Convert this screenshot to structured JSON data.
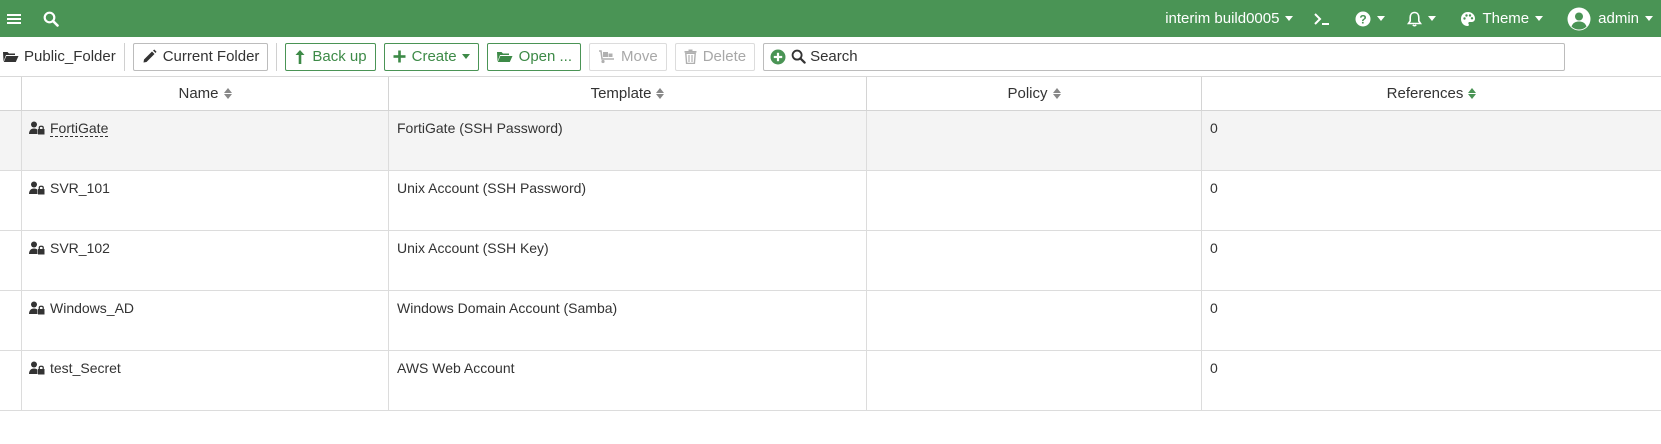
{
  "topbar": {
    "menu_icon": "hamburger-icon",
    "search_icon": "search-icon",
    "build_label": "interim build0005",
    "terminal_icon": "terminal-icon",
    "help_icon": "question-circle-icon",
    "notifications_icon": "bell-icon",
    "theme_icon": "palette-icon",
    "theme_label": "Theme",
    "user_icon": "user-avatar-icon",
    "user_label": "admin",
    "accent_color": "#4a9455"
  },
  "toolbar": {
    "breadcrumb": "Public_Folder",
    "current_folder": "Current Folder",
    "back_up": "Back up",
    "create": "Create",
    "open": "Open ...",
    "move": "Move",
    "delete": "Delete",
    "search_placeholder": "Search"
  },
  "table": {
    "columns": [
      "Name",
      "Template",
      "Policy",
      "References"
    ],
    "rows": [
      {
        "name": "FortiGate",
        "template": "FortiGate (SSH Password)",
        "policy": "",
        "references": "0"
      },
      {
        "name": "SVR_101",
        "template": "Unix Account (SSH Password)",
        "policy": "",
        "references": "0"
      },
      {
        "name": "SVR_102",
        "template": "Unix Account (SSH Key)",
        "policy": "",
        "references": "0"
      },
      {
        "name": "Windows_AD",
        "template": "Windows Domain Account (Samba)",
        "policy": "",
        "references": "0"
      },
      {
        "name": "test_Secret",
        "template": "AWS Web Account",
        "policy": "",
        "references": "0"
      }
    ]
  }
}
